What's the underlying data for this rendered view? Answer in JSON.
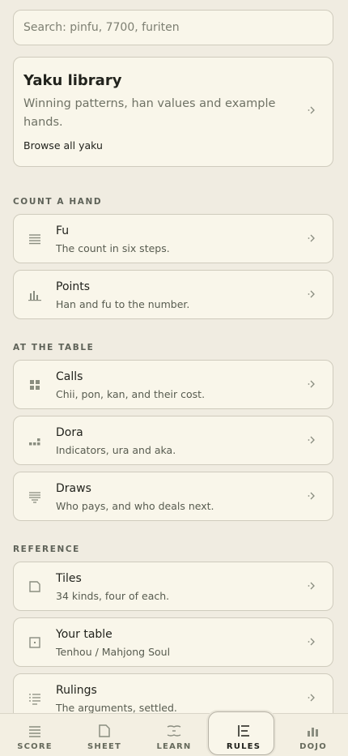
{
  "search": {
    "placeholder": "Search: pinfu, 7700, furiten"
  },
  "featured": {
    "title": "Yaku library",
    "description": "Winning patterns, han values and example hands.",
    "link": "Browse all yaku",
    "icon": "chevron-right-icon"
  },
  "sections": [
    {
      "label": "COUNT A HAND",
      "items": [
        {
          "title": "Fu",
          "subtitle": "The count in six steps.",
          "icon": "lines-icon"
        },
        {
          "title": "Points",
          "subtitle": "Han and fu to the number.",
          "icon": "bar-chart-icon"
        }
      ]
    },
    {
      "label": "AT THE TABLE",
      "items": [
        {
          "title": "Calls",
          "subtitle": "Chii, pon, kan, and their cost.",
          "icon": "grid-icon"
        },
        {
          "title": "Dora",
          "subtitle": "Indicators, ura and aka.",
          "icon": "steps-icon"
        },
        {
          "title": "Draws",
          "subtitle": "Who pays, and who deals next.",
          "icon": "list-icon"
        }
      ]
    },
    {
      "label": "REFERENCE",
      "items": [
        {
          "title": "Tiles",
          "subtitle": "34 kinds, four of each.",
          "icon": "tile-icon"
        },
        {
          "title": "Your table",
          "subtitle": "Tenhou / Mahjong Soul",
          "icon": "table-icon"
        },
        {
          "title": "Rulings",
          "subtitle": "The arguments, settled.",
          "icon": "rulings-icon"
        }
      ]
    }
  ],
  "tabs": [
    {
      "label": "SCORE",
      "icon": "score-icon",
      "active": false
    },
    {
      "label": "SHEET",
      "icon": "sheet-icon",
      "active": false
    },
    {
      "label": "LEARN",
      "icon": "learn-icon",
      "active": false
    },
    {
      "label": "RULES",
      "icon": "rules-icon",
      "active": true
    },
    {
      "label": "DOJO",
      "icon": "dojo-icon",
      "active": false
    }
  ],
  "colors": {
    "background": "#f0ece1",
    "card": "#f9f6ea",
    "border": "#cfcbbd",
    "text": "#22231d",
    "muted": "#6f7265",
    "icon": "#8a8d80"
  }
}
